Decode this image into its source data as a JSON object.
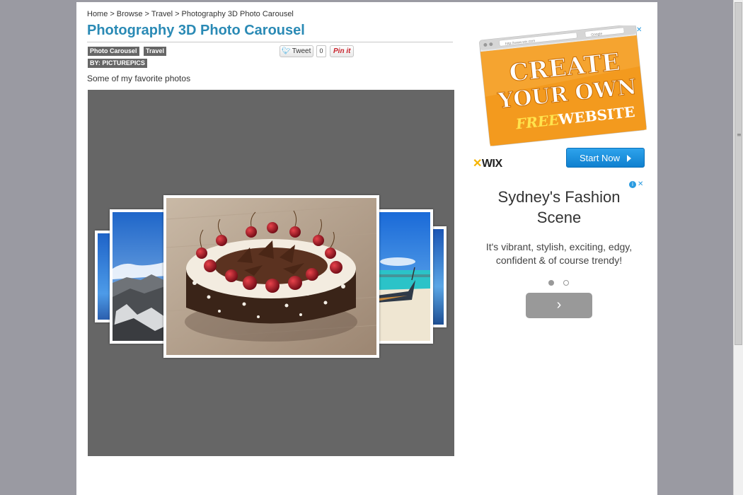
{
  "breadcrumb": {
    "items": [
      "Home",
      "Browse",
      "Travel",
      "Photography 3D Photo Carousel"
    ],
    "separator": ">"
  },
  "page": {
    "title": "Photography 3D Photo Carousel",
    "description": "Some of my favorite photos"
  },
  "tags": [
    "Photo Carousel",
    "Travel"
  ],
  "author": "BY: PICTUREPICS",
  "social": {
    "tweet_label": "Tweet",
    "tweet_count": "0",
    "pinit_label": "Pin it"
  },
  "carousel": {
    "slides": [
      {
        "id": "left-far",
        "subject": "blue sky"
      },
      {
        "id": "left",
        "subject": "mountain landscape"
      },
      {
        "id": "center",
        "subject": "black forest cherry cake"
      },
      {
        "id": "right",
        "subject": "tropical beach with longtail boat"
      },
      {
        "id": "right-far",
        "subject": "blue sky"
      }
    ]
  },
  "ads": {
    "wix": {
      "banner_line1": "CREATE",
      "banner_line2": "YOUR OWN",
      "banner_line3a": "FREE",
      "banner_line3b": "WEBSITE",
      "browser_url": "http://www.wix.com",
      "browser_search": "Google",
      "logo": "WIX",
      "cta": "Start Now"
    },
    "fashion": {
      "title": "Sydney's Fashion Scene",
      "text": "It's vibrant, stylish, exciting, edgy, confident & of course trendy!",
      "dots": 2,
      "active_dot": 1
    },
    "close_icons": [
      "info-icon",
      "close-icon"
    ]
  },
  "colors": {
    "title": "#2a8ab5",
    "carousel_bg": "#666666",
    "wix_orange": "#f39a1e",
    "cta_blue": "#1591df"
  }
}
